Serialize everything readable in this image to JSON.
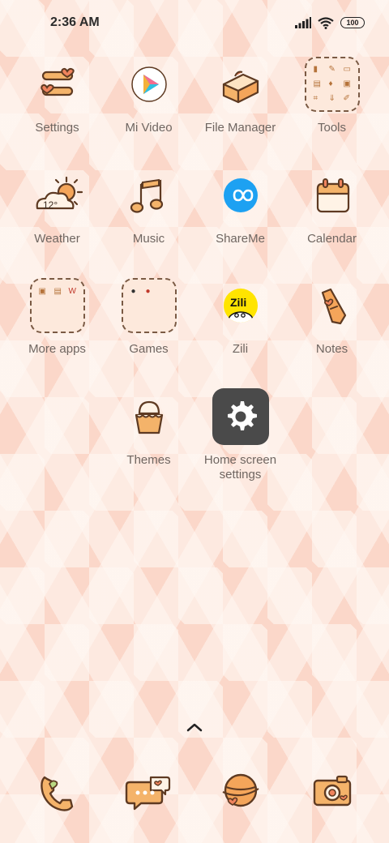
{
  "status_bar": {
    "time": "2:36 AM",
    "battery_level": "100",
    "icons": [
      "signal-icon",
      "wifi-icon",
      "battery-icon"
    ]
  },
  "apps": [
    {
      "label": "Settings",
      "icon": "settings-icon"
    },
    {
      "label": "Mi Video",
      "icon": "mi-video-icon"
    },
    {
      "label": "File Manager",
      "icon": "file-manager-icon"
    },
    {
      "label": "Tools",
      "icon": "folder-icon"
    },
    {
      "label": "Weather",
      "icon": "weather-icon",
      "temperature": "12°"
    },
    {
      "label": "Music",
      "icon": "music-icon"
    },
    {
      "label": "ShareMe",
      "icon": "shareme-icon"
    },
    {
      "label": "Calendar",
      "icon": "calendar-icon"
    },
    {
      "label": "More apps",
      "icon": "folder-icon"
    },
    {
      "label": "Games",
      "icon": "folder-icon"
    },
    {
      "label": "Zili",
      "icon": "zili-icon",
      "badge_text": "Zili"
    },
    {
      "label": "Notes",
      "icon": "notes-icon"
    },
    {
      "label": "Themes",
      "icon": "themes-icon"
    },
    {
      "label": "Home screen settings",
      "icon": "gear-icon"
    }
  ],
  "dock": [
    {
      "icon": "phone-icon"
    },
    {
      "icon": "messages-icon"
    },
    {
      "icon": "browser-icon"
    },
    {
      "icon": "camera-icon"
    }
  ],
  "colors": {
    "outline": "#5e3a22",
    "fill_orange": "#f4b36a",
    "fill_cream": "#fff3e6",
    "heart": "#f0835d",
    "label": "#6f6661"
  }
}
